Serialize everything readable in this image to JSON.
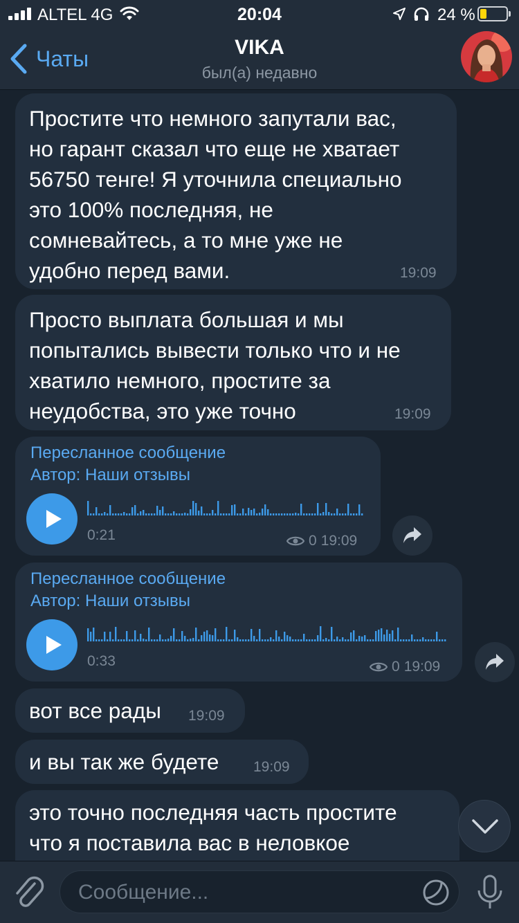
{
  "status_bar": {
    "carrier": "ALTEL 4G",
    "time": "20:04",
    "battery_percent": "24 %",
    "battery_level": 0.24
  },
  "header": {
    "back_label": "Чаты",
    "title": "VIKA",
    "subtitle": "был(а) недавно"
  },
  "messages": [
    {
      "type": "text",
      "lines": [
        "Простите что немного запутали вас,",
        "но гарант сказал что еще не хватает",
        "56750 тенге! Я уточнила специально",
        "это 100% последняя, не",
        "сомневайтесь, а то мне уже не",
        "удобно перед вами."
      ],
      "time": "19:09"
    },
    {
      "type": "text",
      "lines": [
        "Просто выплата большая и мы",
        "попытались вывести только что и не",
        "хватило немного, простите за",
        "неудобства, это уже точно"
      ],
      "time": "19:09"
    },
    {
      "type": "forwarded_voice",
      "forward_label": "Пересланное сообщение",
      "author": "Автор: Наши отзывы",
      "duration": "0:21",
      "views": "0",
      "time": "19:09"
    },
    {
      "type": "forwarded_voice",
      "forward_label": "Пересланное сообщение",
      "author": "Автор: Наши отзывы",
      "duration": "0:33",
      "views": "0",
      "time": "19:09"
    },
    {
      "type": "text",
      "lines": [
        "вот все рады"
      ],
      "time": "19:09"
    },
    {
      "type": "text",
      "lines": [
        "и вы так же будете"
      ],
      "time": "19:09"
    },
    {
      "type": "text",
      "lines": [
        "это точно последняя часть простите",
        "что я поставила вас в неловкое"
      ]
    }
  ],
  "input": {
    "placeholder": "Сообщение..."
  },
  "icons": {
    "back": "chevron-left-icon",
    "attach": "paperclip-icon",
    "sticker": "sticker-icon",
    "mic": "microphone-icon",
    "share": "share-arrow-icon",
    "scroll_down": "chevron-down-icon",
    "views": "eye-icon",
    "play": "play-icon"
  },
  "colors": {
    "background": "#18222d",
    "bubble": "#222f3e",
    "accent": "#5aaaf2",
    "play": "#3d9ae8",
    "battery": "#ffd60a"
  }
}
